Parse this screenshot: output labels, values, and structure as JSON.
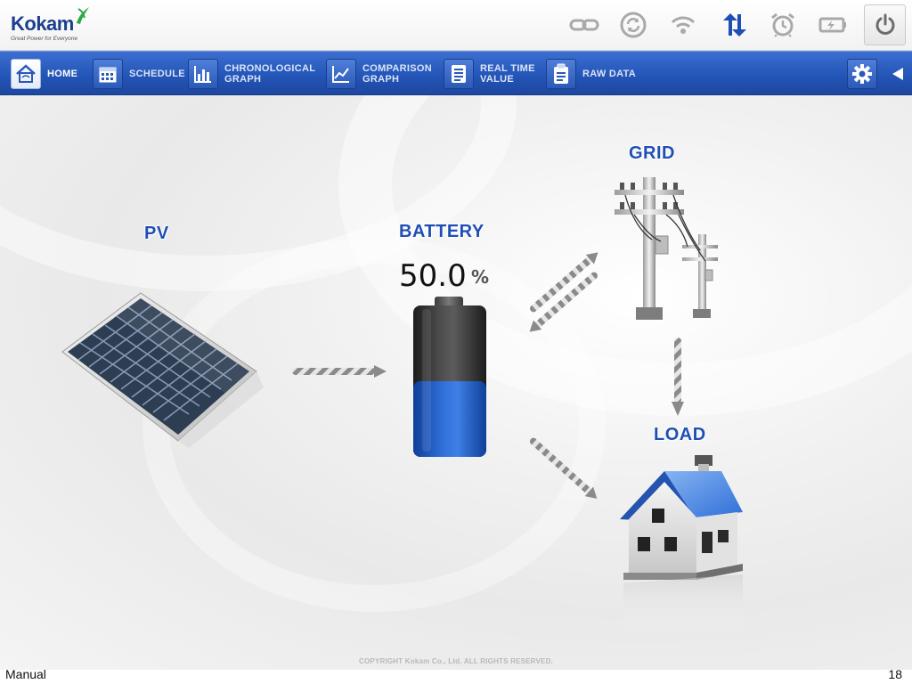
{
  "brand": {
    "name": "Kokam",
    "tagline": "Great Power for Everyone"
  },
  "status_icons": [
    {
      "name": "link-icon"
    },
    {
      "name": "sync-icon"
    },
    {
      "name": "wifi-icon"
    },
    {
      "name": "transfer-arrows-icon",
      "color": "#1f4fb5"
    },
    {
      "name": "alarm-clock-icon"
    },
    {
      "name": "battery-status-icon"
    }
  ],
  "power_button": {
    "icon": "power-icon"
  },
  "nav": {
    "items": [
      {
        "id": "home",
        "label": "HOME",
        "icon": "home-icon",
        "active": true
      },
      {
        "id": "schedule",
        "label": "SCHEDULE",
        "icon": "calendar-icon"
      },
      {
        "id": "chronological",
        "label": "CHRONOLOGICAL\nGRAPH",
        "icon": "bar-chart-icon"
      },
      {
        "id": "comparison",
        "label": "COMPARISON\nGRAPH",
        "icon": "line-chart-icon"
      },
      {
        "id": "realtime",
        "label": "REAL TIME\nVALUE",
        "icon": "list-icon"
      },
      {
        "id": "rawdata",
        "label": "RAW DATA",
        "icon": "clipboard-icon"
      }
    ],
    "settings_icon": "gear-icon",
    "collapse_icon": "triangle-left-icon"
  },
  "diagram": {
    "pv_label": "PV",
    "battery_label": "BATTERY",
    "battery_value": "50.0",
    "battery_unit": "%",
    "battery_level": 0.5,
    "grid_label": "GRID",
    "load_label": "LOAD"
  },
  "copyright": "COPYRIGHT Kokam Co., Ltd. ALL RIGHTS RESERVED.",
  "footer": {
    "left": "Manual",
    "right": "18"
  },
  "colors": {
    "accent": "#1f4fb5",
    "nav_bg": "#2455b8",
    "battery_fill": "#2f6fd8"
  }
}
